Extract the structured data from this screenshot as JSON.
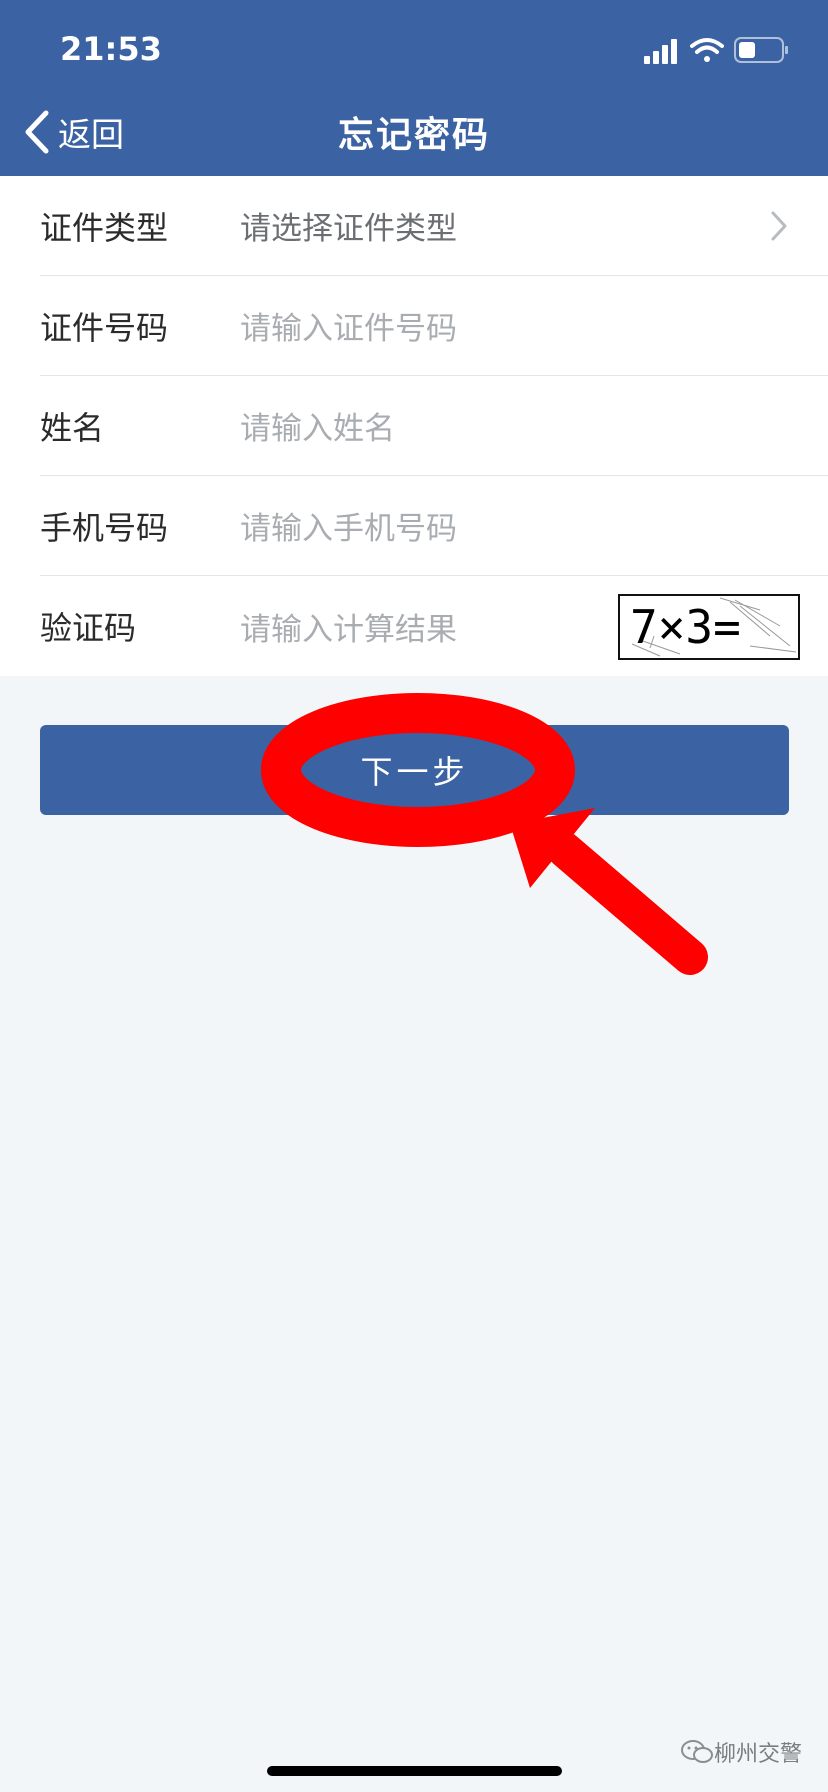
{
  "status_bar": {
    "time": "21:53",
    "icons": [
      "signal-icon",
      "wifi-icon",
      "battery-icon"
    ]
  },
  "nav": {
    "back_label": "返回",
    "title": "忘记密码"
  },
  "form": {
    "rows": [
      {
        "label": "证件类型",
        "value": "请选择证件类型"
      },
      {
        "label": "证件号码",
        "placeholder": "请输入证件号码"
      },
      {
        "label": "姓名",
        "placeholder": "请输入姓名"
      },
      {
        "label": "手机号码",
        "placeholder": "请输入手机号码"
      },
      {
        "label": "验证码",
        "placeholder": "请输入计算结果",
        "captcha": "7×3="
      }
    ]
  },
  "next_button": {
    "label": "下一步"
  },
  "watermark": {
    "text": "柳州交警"
  },
  "colors": {
    "header": "#3b62a3",
    "button": "#3b62a3",
    "annotation": "#ff0000",
    "background": "#f3f6f8"
  }
}
